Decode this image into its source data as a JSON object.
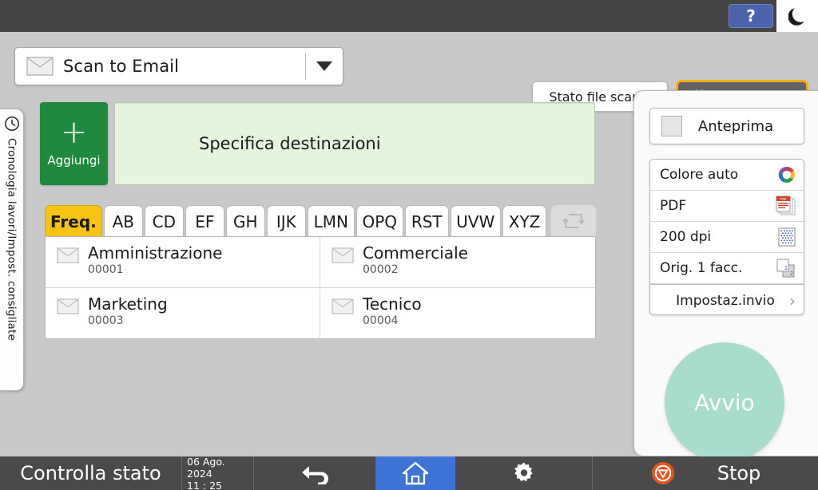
{
  "topbar": {
    "help_label": "?",
    "help_icon": "question-mark-icon",
    "sleep_icon": "moon-icon",
    "help_color": "#4a63ab"
  },
  "function_header": {
    "mode_icon": "envelope-icon",
    "mode_label": "Scan to Email",
    "dropdown_icon": "caret-down-icon",
    "scan_status_label": "Stato file scans.",
    "reset_label": "Azzera",
    "reset_icon": "reset-slash-icon",
    "reset_border_color": "#f2ad17"
  },
  "left_tab": {
    "icon": "clock-icon",
    "label": "Cronologia lavori/Impost. consigliate"
  },
  "destination": {
    "add_icon": "plus-icon",
    "add_label": "Aggiungi",
    "add_color": "#1f8a3e",
    "field_placeholder": "Specifica destinazioni",
    "field_color": "#e4f4dd"
  },
  "alphabet_tabs": {
    "active": "Freq.",
    "active_color": "#f7c315",
    "items": [
      {
        "label": "Freq.",
        "active": true
      },
      {
        "label": "AB",
        "active": false
      },
      {
        "label": "CD",
        "active": false
      },
      {
        "label": "EF",
        "active": false
      },
      {
        "label": "GH",
        "active": false
      },
      {
        "label": "IJK",
        "active": false
      },
      {
        "label": "LMN",
        "active": false
      },
      {
        "label": "OPQ",
        "active": false
      },
      {
        "label": "RST",
        "active": false
      },
      {
        "label": "UVW",
        "active": false
      },
      {
        "label": "XYZ",
        "active": false
      }
    ],
    "switch_icon": "switch-list-icon"
  },
  "contacts": [
    {
      "icon": "envelope-icon",
      "name": "Amministrazione",
      "code": "00001"
    },
    {
      "icon": "envelope-icon",
      "name": "Commerciale",
      "code": "00002"
    },
    {
      "icon": "envelope-icon",
      "name": "Marketing",
      "code": "00003"
    },
    {
      "icon": "envelope-icon",
      "name": "Tecnico",
      "code": "00004"
    }
  ],
  "right_panel": {
    "preview_label": "Anteprima",
    "preview_checkbox_icon": "checkbox-unchecked-icon",
    "settings": [
      {
        "label": "Colore auto",
        "icon": "auto-color-icon"
      },
      {
        "label": "PDF",
        "icon": "pdf-file-icon"
      },
      {
        "label": "200 dpi",
        "icon": "resolution-icon"
      },
      {
        "label": "Orig. 1 facc.",
        "icon": "one-sided-original-icon"
      }
    ],
    "send_settings_label": "Impostaz.invio",
    "send_settings_chevron": "chevron-right-icon",
    "start_label": "Avvio",
    "start_color": "#a8ddcd"
  },
  "bottombar": {
    "check_status_label": "Controlla stato",
    "date": "06 Ago. 2024",
    "time": "11 : 25",
    "back_icon": "back-arrow-icon",
    "home_icon": "home-icon",
    "home_color": "#3d72d7",
    "gear_icon": "gear-icon",
    "stop_icon": "stop-circle-icon",
    "stop_label": "Stop"
  }
}
